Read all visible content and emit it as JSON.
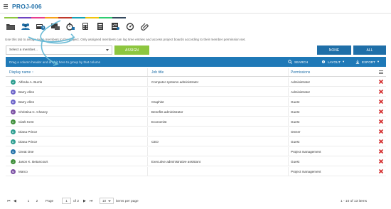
{
  "header": {
    "title": "PROJ-006"
  },
  "color_strip": [
    "#8dc63f",
    "#6f42c1",
    "#e83e8c",
    "#f7a21b",
    "#c0392b",
    "#17a2b8",
    "#f1c40f",
    "#2ecc71",
    "#34495e"
  ],
  "toolbar": {
    "tools": [
      {
        "icon": "folder-icon"
      },
      {
        "icon": "members-icon"
      },
      {
        "icon": "timesheet-icon"
      },
      {
        "icon": "board-icon"
      },
      {
        "icon": "stopwatch-icon"
      },
      {
        "icon": "calculator-icon"
      },
      {
        "icon": "document-icon"
      },
      {
        "icon": "checklist-icon"
      },
      {
        "icon": "gauge-icon"
      },
      {
        "icon": "attachment-icon"
      }
    ]
  },
  "hint": "Use this tab to assign team members to the project. Only assigned members can log time entries and access project boards according to their member permission set.",
  "assign": {
    "select_placeholder": "Select a member...",
    "assign_label": "ASSIGN",
    "none_label": "NONE",
    "all_label": "ALL"
  },
  "groupbar": {
    "hint": "Drag a column header and drop it here to group by that column",
    "search_label": "SEARCH",
    "layout_label": "LAYOUT",
    "export_label": "EXPORT"
  },
  "grid": {
    "columns": [
      "Display name",
      "Job title",
      "Permissions"
    ],
    "rows": [
      {
        "initial": "A",
        "color": "#2a9d8f",
        "name": "Alfreda A. Burris",
        "job": "Computer systems administrator",
        "perm": "Administrator"
      },
      {
        "initial": "B",
        "color": "#6c63c9",
        "name": "Barry Allen",
        "job": "",
        "perm": "Administrator"
      },
      {
        "initial": "B",
        "color": "#6c63c9",
        "name": "Barry Allen",
        "job": "Graphist",
        "perm": "Guest"
      },
      {
        "initial": "C",
        "color": "#7b4fa3",
        "name": "Christina C. Chaney",
        "job": "Benefits administrator",
        "perm": "Guest"
      },
      {
        "initial": "C",
        "color": "#3f8f3a",
        "name": "Clark Kent",
        "job": "Economist",
        "perm": "Guest"
      },
      {
        "initial": "D",
        "color": "#2a9d8f",
        "name": "Diana Prince",
        "job": "",
        "perm": "Owner"
      },
      {
        "initial": "D",
        "color": "#2a9d8f",
        "name": "Diana Prince",
        "job": "CEO",
        "perm": "Guest"
      },
      {
        "initial": "G",
        "color": "#1f6fa8",
        "name": "Great One",
        "job": "",
        "perm": "Project management"
      },
      {
        "initial": "J",
        "color": "#3f8f3a",
        "name": "Jason K. Betancourt",
        "job": "Executive administrative assistant",
        "perm": "Guest"
      },
      {
        "initial": "M",
        "color": "#7b4fa3",
        "name": "Marco",
        "job": "",
        "perm": "Project management"
      }
    ]
  },
  "pager": {
    "page_1": "1",
    "page_2": "2",
    "page_label": "Page",
    "page_value": "1",
    "of_label": "of 2",
    "size_value": "10",
    "size_label": "items per page",
    "summary": "1 - 10 of 13 items"
  }
}
